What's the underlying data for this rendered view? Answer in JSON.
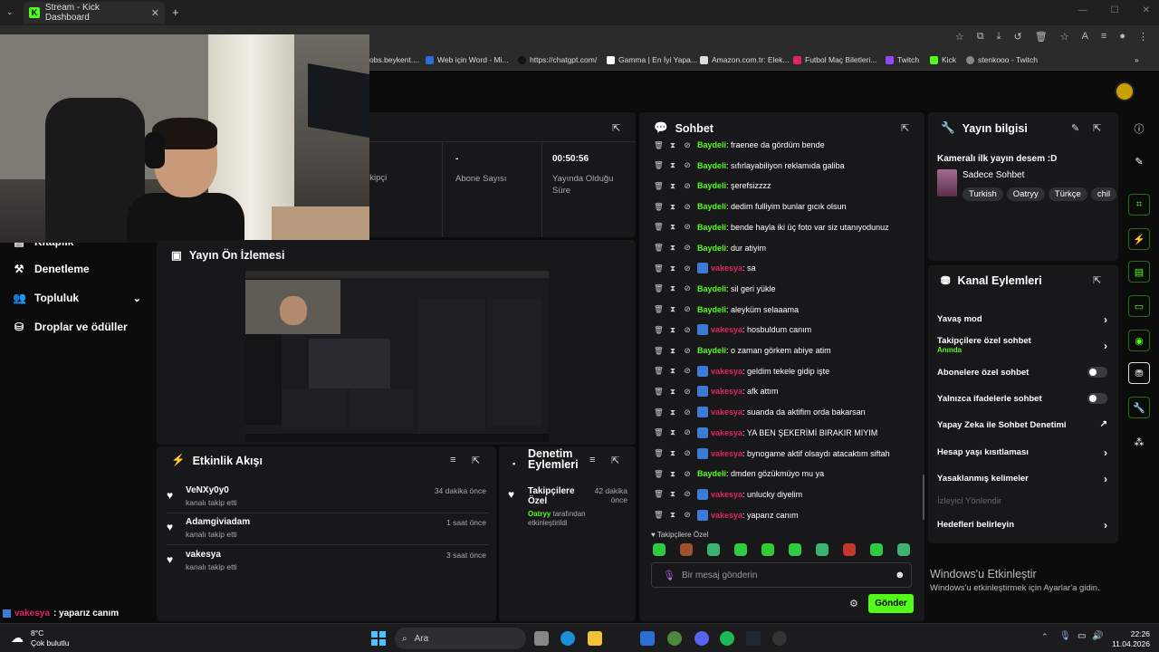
{
  "browser": {
    "tab_title": "Stream - Kick Dashboard",
    "tab_favicon": "K",
    "bookmarks": [
      "obs.beykent....",
      "Web için Word - Mi...",
      "https://chatgpt.com/",
      "Gamma | En İyi Yapa...",
      "Amazon.com.tr: Elek...",
      "Futbol Maç Biletleri...",
      "Twitch",
      "Kick",
      "stenkooo - Twitch"
    ]
  },
  "sidebar": {
    "partial_label": "Kitaplık",
    "items": [
      {
        "label": "Denetleme",
        "icon": "gavel-icon"
      },
      {
        "label": "Topluluk",
        "icon": "people-icon"
      },
      {
        "label": "Droplar ve ödüller",
        "icon": "gift-icon"
      }
    ]
  },
  "stats": {
    "partial_label": "akipçi",
    "sub_value": "-",
    "sub_label": "Abone Sayısı",
    "live_value": "00:50:56",
    "live_label": "Yayında Olduğu Süre"
  },
  "preview": {
    "title": "Yayın Ön İzlemesi"
  },
  "activity": {
    "title": "Etkinlik Akışı",
    "items": [
      {
        "user": "VeNXy0y0",
        "action": "kanalı takip etti",
        "time": "34 dakika önce"
      },
      {
        "user": "Adamgiviadam",
        "action": "kanalı takip etti",
        "time": "1 saat önce"
      },
      {
        "user": "vakesya",
        "action": "kanalı takip etti",
        "time": "3 saat önce"
      }
    ]
  },
  "mod_actions": {
    "title_line1": "Denetim",
    "title_line2": "Eylemleri",
    "item_title": "Takipçilere Özel",
    "item_time": "42 dakika önce",
    "item_user": "Oatryy",
    "item_desc": "tarafından etkinleştirildi"
  },
  "chat": {
    "title": "Sohbet",
    "messages": [
      {
        "user": "Baydeli",
        "color": "green",
        "text": ": fraenee da gördüm bende"
      },
      {
        "user": "Baydeli",
        "color": "green",
        "text": ": sıfırlayabiliyon reklamıda galiba"
      },
      {
        "user": "Baydeli",
        "color": "green",
        "text": ": şerefsizzzz"
      },
      {
        "user": "Baydeli",
        "color": "green",
        "text": ": dedim fulliyim bunlar gıcık olsun"
      },
      {
        "user": "Baydeli",
        "color": "green",
        "text": ": bende hayla iki üç foto var siz utanıyodunuz"
      },
      {
        "user": "Baydeli",
        "color": "green",
        "text": ": dur atiyim"
      },
      {
        "user": "vakesya",
        "color": "red",
        "text": ": sa"
      },
      {
        "user": "Baydeli",
        "color": "green",
        "text": ": sil geri yükle"
      },
      {
        "user": "Baydeli",
        "color": "green",
        "text": ": aleyküm selaaama"
      },
      {
        "user": "vakesya",
        "color": "red",
        "text": ": hosbuldum canım"
      },
      {
        "user": "Baydeli",
        "color": "green",
        "text": ": o zaman görkem abiye atim"
      },
      {
        "user": "vakesya",
        "color": "red",
        "text": ": geldim tekele gidip işte"
      },
      {
        "user": "vakesya",
        "color": "red",
        "text": ": afk attım"
      },
      {
        "user": "vakesya",
        "color": "red",
        "text": ": suanda da aktifim orda bakarsan"
      },
      {
        "user": "vakesya",
        "color": "red",
        "text": ": YA BEN ŞEKERİMİ BIRAKIR MIYIM"
      },
      {
        "user": "vakesya",
        "color": "red",
        "text": ": bynogame aktif olsaydı atacaktım siftah"
      },
      {
        "user": "Baydeli",
        "color": "green",
        "text": ": dmden gözükmüyo mu ya"
      },
      {
        "user": "vakesya",
        "color": "red",
        "text": ": unlucky diyelim"
      },
      {
        "user": "vakesya",
        "color": "red",
        "text": ": yaparız canım"
      }
    ],
    "mode_label": "Takipçilere Özel",
    "input_placeholder": "Bir mesaj gönderin",
    "send_label": "Gönder"
  },
  "stream_info": {
    "title": "Yayın bilgisi",
    "stream_title": "Kameralı ilk yayın desem :D",
    "category": "Sadece Sohbet",
    "tags": [
      "Turkish",
      "Oatryy",
      "Türkçe",
      "chil"
    ]
  },
  "channel_actions": {
    "title": "Kanal Eylemleri",
    "slow_mode": "Yavaş mod",
    "followers_only": "Takipçilere özel sohbet",
    "followers_only_status": "Anında",
    "subs_only": "Abonelere özel sohbet",
    "emotes_only": "Yalnızca ifadelerle sohbet",
    "ai_moderation": "Yapay Zeka ile Sohbet Denetimi",
    "account_age": "Hesap yaşı kısıtlaması",
    "banned_words": "Yasaklanmış kelimeler",
    "viewer_redirect": "İzleyici Yönlendir",
    "goals": "Hedefleri belirleyin"
  },
  "watermark": {
    "line1": "Windows'u Etkinleştir",
    "line2": "Windows'u etkinleştirmek için Ayarlar'a gidin."
  },
  "overlay": {
    "user": "vakesya",
    "text": " : yaparız canım"
  },
  "taskbar": {
    "weather_temp": "8°C",
    "weather_desc": "Çok bulutlu",
    "search_label": "Ara",
    "time": "22:26",
    "date": "11.04.2026"
  }
}
